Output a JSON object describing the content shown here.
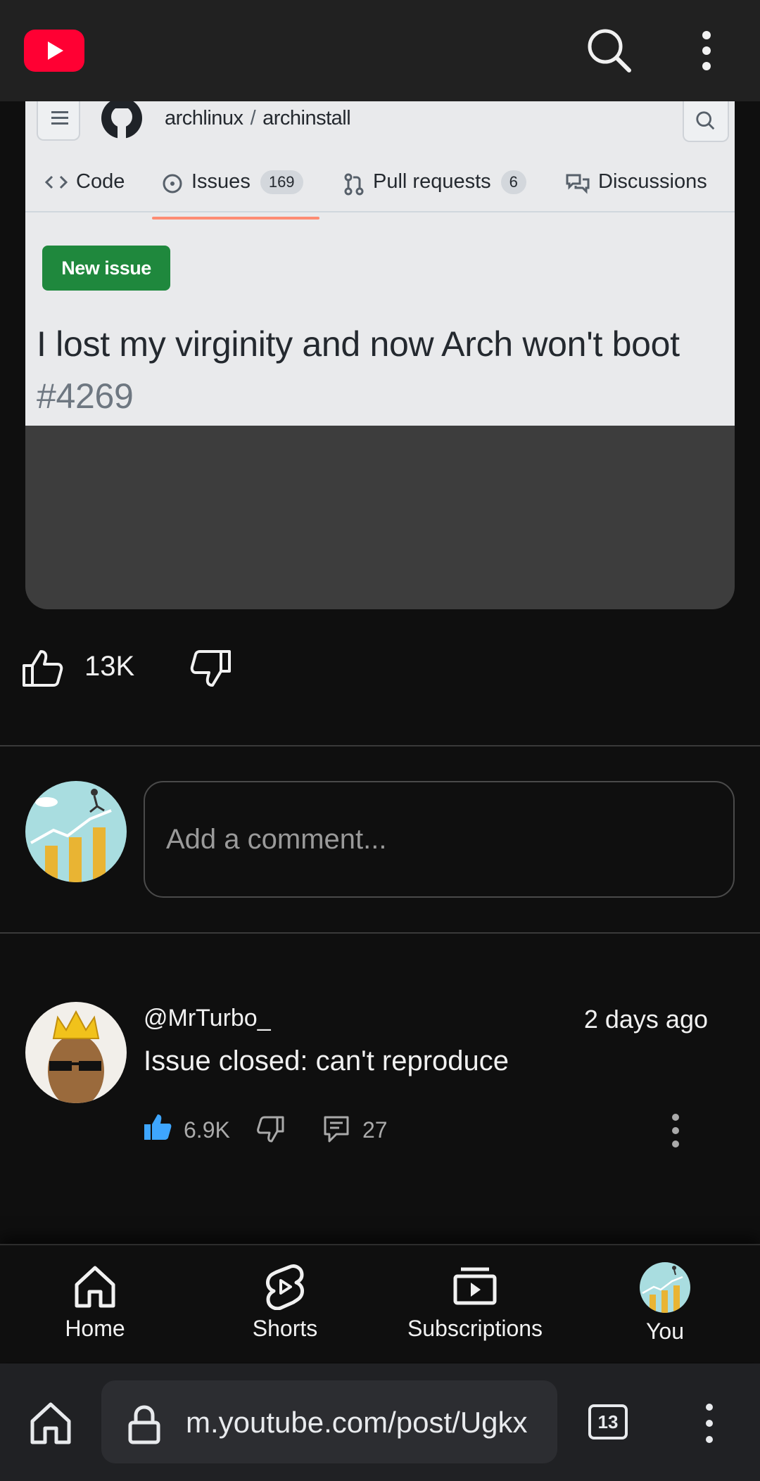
{
  "app_bar": {
    "logo_icon": "youtube-logo-icon",
    "search_icon": "search-icon",
    "more_icon": "more-vert-icon"
  },
  "post_image": {
    "repo_owner": "archlinux",
    "repo_separator": "/",
    "repo_name": "archinstall",
    "tabs": [
      {
        "label": "Code",
        "icon": "code-icon"
      },
      {
        "label": "Issues",
        "count": "169",
        "icon": "issue-icon"
      },
      {
        "label": "Pull requests",
        "count": "6",
        "icon": "pull-request-icon"
      },
      {
        "label": "Discussions",
        "icon": "discussions-icon"
      }
    ],
    "new_issue_label": "New issue",
    "issue_title": "I lost my virginity and now Arch won't boot",
    "issue_number": "#4269"
  },
  "reactions": {
    "like_count": "13K"
  },
  "add_comment": {
    "placeholder": "Add a comment..."
  },
  "comments": [
    {
      "author": "@MrTurbo_",
      "time": "2 days ago",
      "text": "Issue closed: can't reproduce",
      "like_count": "6.9K",
      "reply_count": "27",
      "liked": true
    }
  ],
  "bottom_nav": {
    "items": [
      {
        "label": "Home",
        "icon": "home-icon"
      },
      {
        "label": "Shorts",
        "icon": "shorts-icon"
      },
      {
        "label": "Subscriptions",
        "icon": "subscriptions-icon"
      },
      {
        "label": "You",
        "icon": "avatar"
      }
    ]
  },
  "browser": {
    "url": "m.youtube.com/post/Ugkx",
    "tab_count": "13"
  },
  "colors": {
    "youtube_red": "#ff0033",
    "github_green": "#1f883d",
    "like_active_blue": "#3ea6ff",
    "issue_tab_underline": "#fd8c73"
  }
}
